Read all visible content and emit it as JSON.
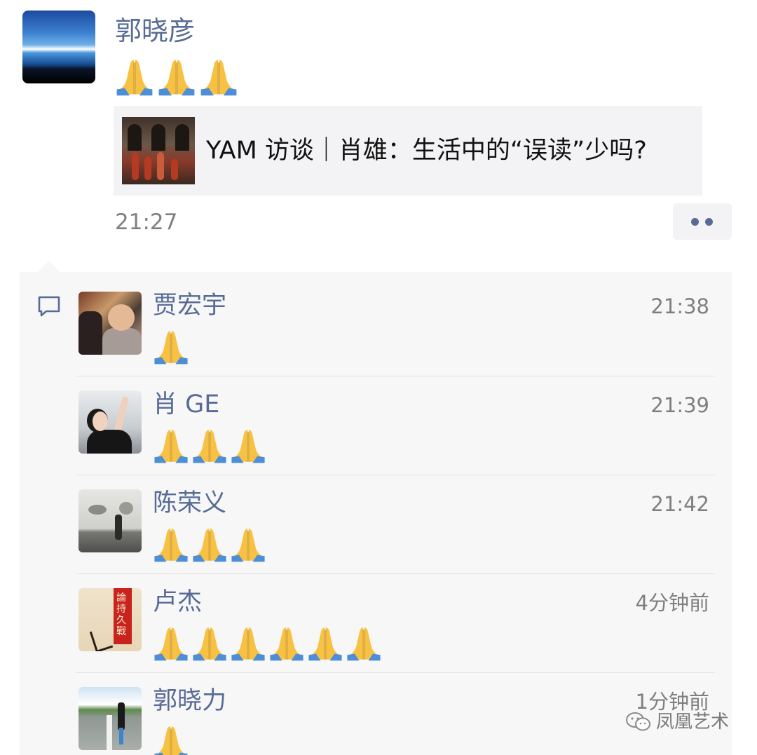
{
  "post": {
    "author": "郭晓彦",
    "text_emoji": [
      "🙏",
      "🙏",
      "🙏"
    ],
    "link_title": "YAM 访谈｜肖雄：生活中的“误读”少吗?",
    "time": "21:27"
  },
  "comments": [
    {
      "name": "贾宏宇",
      "time": "21:38",
      "emoji": [
        "🙏"
      ]
    },
    {
      "name": "肖 GE",
      "time": "21:39",
      "emoji": [
        "🙏",
        "🙏",
        "🙏"
      ]
    },
    {
      "name": "陈荣义",
      "time": "21:42",
      "emoji": [
        "🙏",
        "🙏",
        "🙏"
      ]
    },
    {
      "name": "卢杰",
      "time": "4分钟前",
      "emoji": [
        "🙏",
        "🙏",
        "🙏",
        "🙏",
        "🙏",
        "🙏"
      ]
    },
    {
      "name": "郭晓力",
      "time": "1分钟前",
      "emoji": [
        "🙏"
      ]
    }
  ],
  "avatar_texts": {
    "book_cover": "論持久戰"
  },
  "watermark": {
    "text": "凤凰艺术"
  },
  "colors": {
    "name": "#576b95",
    "time": "#7f7f7f",
    "panel": "#f7f7f7",
    "card": "#f3f3f5"
  },
  "icons": [
    "pray-hands-icon",
    "comment-icon",
    "more-dots-icon",
    "wechat-logo-icon"
  ]
}
